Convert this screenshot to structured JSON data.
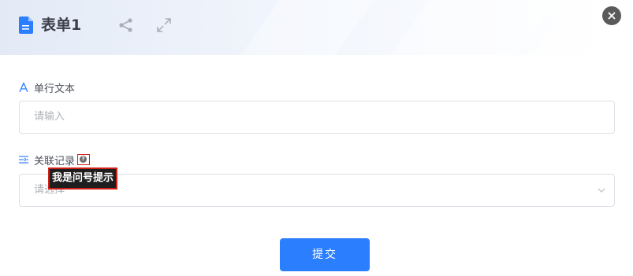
{
  "header": {
    "title": "表单1",
    "icons": {
      "doc": "document-icon",
      "share": "share-icon",
      "expand": "expand-icon",
      "close": "close-icon"
    }
  },
  "form": {
    "fields": [
      {
        "label": "单行文本",
        "icon": "text-field-icon",
        "placeholder": "请输入"
      },
      {
        "label": "关联记录",
        "icon": "linked-record-icon",
        "placeholder": "请选择",
        "help_tooltip": "我是问号提示"
      }
    ],
    "submit_label": "提交"
  },
  "colors": {
    "primary": "#2b7fff",
    "header_bg": "#e3eaf6",
    "tooltip_bg": "#1e1e1e",
    "highlight_border": "#d0201b",
    "label_icon": "#2b7fff"
  }
}
